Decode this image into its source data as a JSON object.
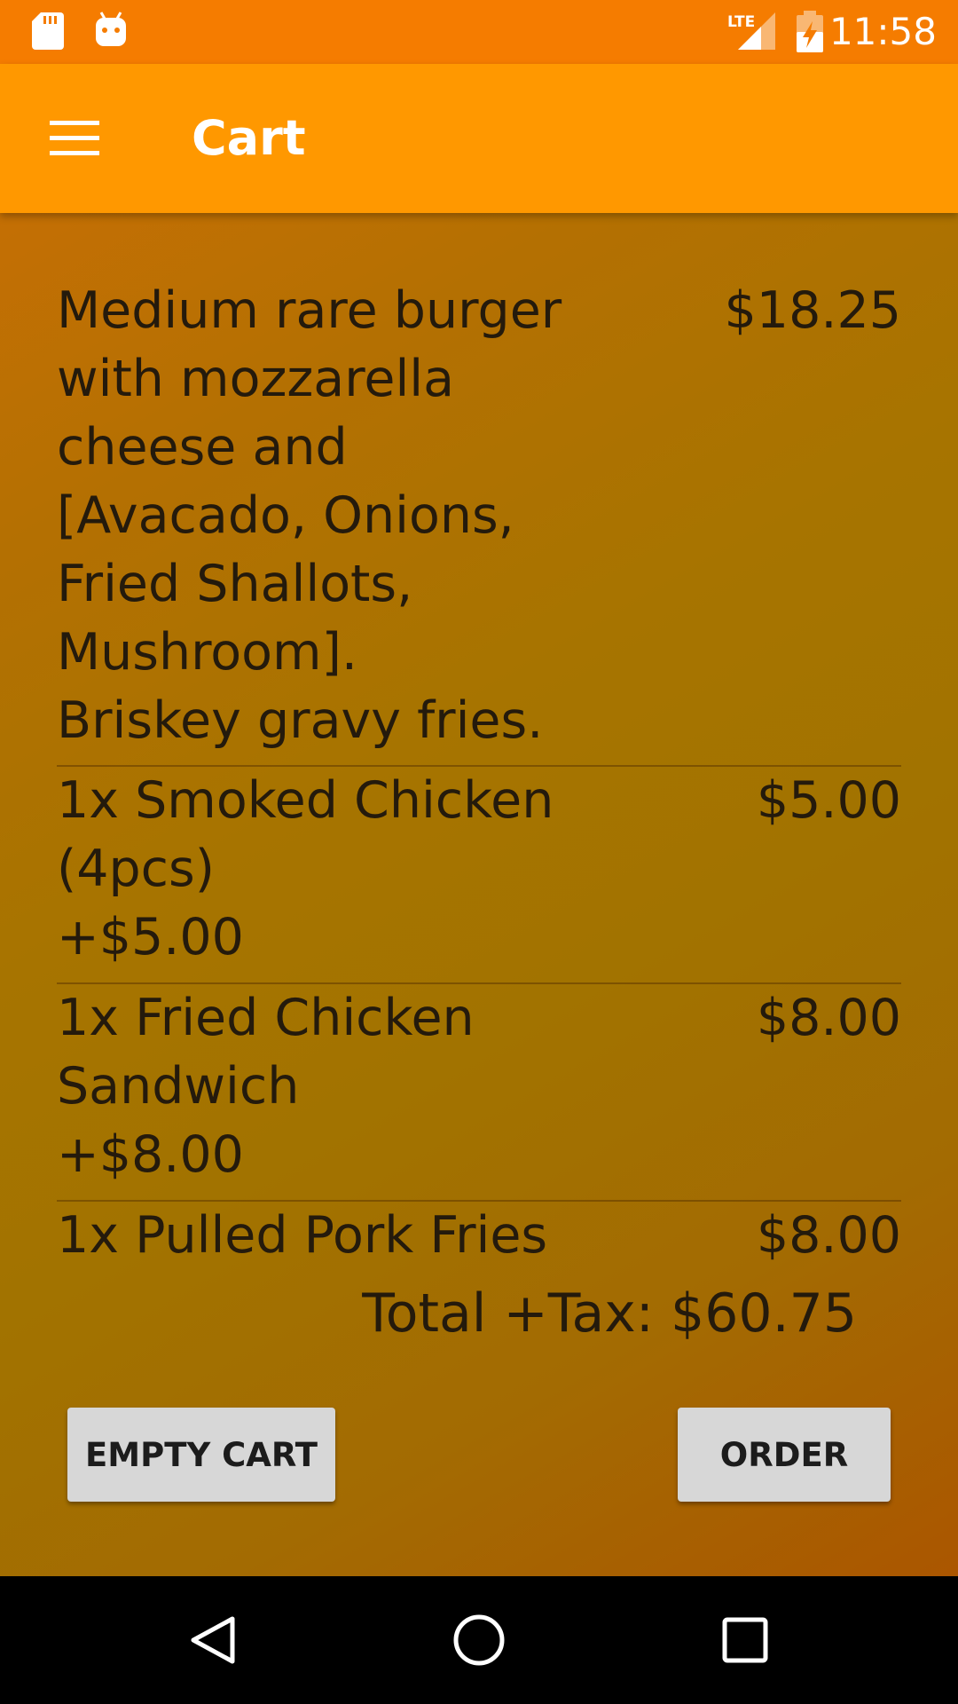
{
  "status_bar": {
    "time": "11:58",
    "network_label": "LTE",
    "icons": [
      "sd-card-icon",
      "android-icon",
      "lte-signal-icon",
      "battery-charging-icon"
    ]
  },
  "app_bar": {
    "title": "Cart",
    "menu_icon": "hamburger-menu-icon"
  },
  "cart": {
    "items": [
      {
        "description": "Medium rare burger\nwith mozzarella\ncheese and\n[Avacado, Onions,\nFried Shallots,\nMushroom].\nBriskey gravy fries.",
        "price": "$18.25"
      },
      {
        "description": "1x Smoked Chicken\n(4pcs)\n+$5.00",
        "price": "$5.00"
      },
      {
        "description": "1x Fried Chicken\nSandwich\n+$8.00",
        "price": "$8.00"
      },
      {
        "description": "1x Pulled Pork Fries",
        "price": "$8.00"
      }
    ],
    "total": "Total +Tax: $60.75"
  },
  "actions": {
    "empty_cart_label": "EMPTY CART",
    "order_label": "ORDER"
  },
  "nav_bar": {
    "icons": [
      "back-icon",
      "home-icon",
      "recents-icon"
    ]
  },
  "colors": {
    "status_bar": "#f57c00",
    "app_bar": "#ff9800",
    "background_start": "#c46f04",
    "background_end": "#ab5600",
    "button": "#d7d7d7",
    "text": "#241a0c"
  }
}
